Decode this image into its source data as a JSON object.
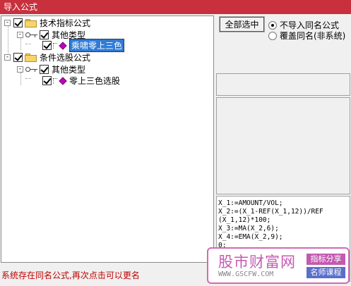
{
  "window": {
    "title": "导入公式"
  },
  "tree": {
    "nodes": [
      {
        "label": "技术指标公式",
        "level": 0,
        "type": "folder",
        "expanded": true,
        "checked": true
      },
      {
        "label": "其他类型",
        "level": 1,
        "type": "key",
        "expanded": true,
        "checked": true
      },
      {
        "label": "乘啸零上三色",
        "level": 2,
        "type": "formula",
        "checked": true,
        "selected": true
      },
      {
        "label": "条件选股公式",
        "level": 0,
        "type": "folder",
        "expanded": true,
        "checked": true
      },
      {
        "label": "其他类型",
        "level": 1,
        "type": "key",
        "expanded": true,
        "checked": true
      },
      {
        "label": "零上三色选股",
        "level": 2,
        "type": "formula",
        "checked": true,
        "selected": false
      }
    ],
    "expand_glyph": "-"
  },
  "options": {
    "select_all_label": "全部选中",
    "radio_skip_label": "不导入同名公式",
    "radio_overwrite_label": "覆盖同名(非系统)",
    "selected_radio": "skip"
  },
  "code_lines": [
    "X_1:=AMOUNT/VOL;",
    "X_2:=(X_1-REF(X_1,12))/REF",
    "(X_1,12)*100;",
    "X_3:=MA(X_2,6);",
    "X_4:=EMA(X_2,9);",
    "0;"
  ],
  "status": {
    "message": "系统存在同名公式,再次点击可以更名"
  },
  "watermark": {
    "brand": "股市财富网",
    "url": "WWW.GSCFW.COM",
    "tag1": "指标分享",
    "tag2": "名师课程"
  },
  "colors": {
    "titlebar": "#c8303d",
    "selection": "#2f7bd6",
    "status_text": "#c00000",
    "watermark_pink": "#c55ab2",
    "tag1_bg": "#c35ab0",
    "tag2_bg": "#5a6fc8"
  }
}
